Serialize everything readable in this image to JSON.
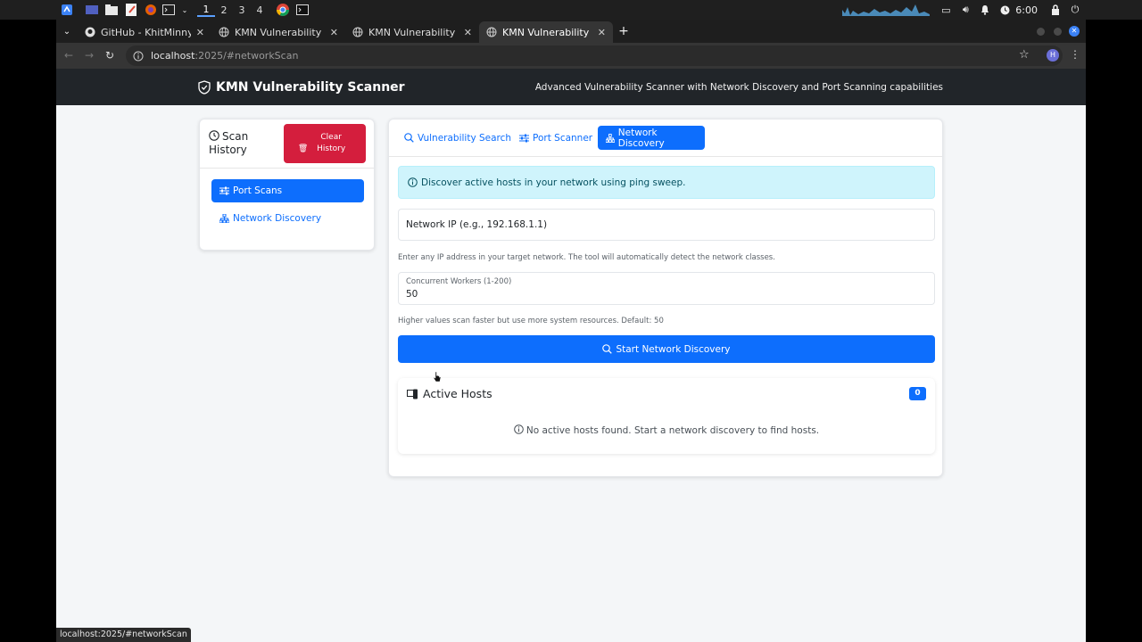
{
  "taskbar": {
    "workspaces": [
      "1",
      "2",
      "3",
      "4"
    ],
    "active_workspace": "1",
    "clock": "6:00"
  },
  "browser": {
    "tabs": [
      {
        "label": "GitHub - KhitMinnyo/KM",
        "icon": "github-icon"
      },
      {
        "label": "KMN Vulnerability Scanne",
        "icon": "globe-icon"
      },
      {
        "label": "KMN Vulnerability Scanne",
        "icon": "globe-icon"
      },
      {
        "label": "KMN Vulnerability Scanne",
        "icon": "globe-icon"
      }
    ],
    "active_tab_index": 3,
    "url_host": "localhost",
    "url_path": ":2025/#networkScan",
    "profile_initial": "H",
    "status_tip": "localhost:2025/#networkScan"
  },
  "header": {
    "brand": "KMN Vulnerability Scanner",
    "tagline": "Advanced Vulnerability Scanner with Network Discovery and Port Scanning capabilities"
  },
  "history": {
    "title": "Scan History",
    "clear_label": "Clear History",
    "items": [
      {
        "label": "Port Scans",
        "active": true
      },
      {
        "label": "Network Discovery",
        "active": false
      }
    ]
  },
  "tabs": [
    {
      "label": "Vulnerability Search",
      "active": false
    },
    {
      "label": "Port Scanner",
      "active": false
    },
    {
      "label": "Network Discovery",
      "active": true
    }
  ],
  "network": {
    "info": "Discover active hosts in your network using ping sweep.",
    "ip_placeholder": "Network IP (e.g., 192.168.1.1)",
    "ip_help": "Enter any IP address in your target network. The tool will automatically detect the network classes.",
    "workers_label": "Concurrent Workers (1-200)",
    "workers_value": "50",
    "workers_help": "Higher values scan faster but use more system resources. Default: 50",
    "start_label": "Start Network Discovery"
  },
  "hosts": {
    "title": "Active Hosts",
    "count": "0",
    "empty_message": "No active hosts found. Start a network discovery to find hosts."
  },
  "colors": {
    "primary": "#0d6efd",
    "danger": "#d41e3d",
    "header_bg": "#212529",
    "info_bg": "#cff4fc"
  }
}
